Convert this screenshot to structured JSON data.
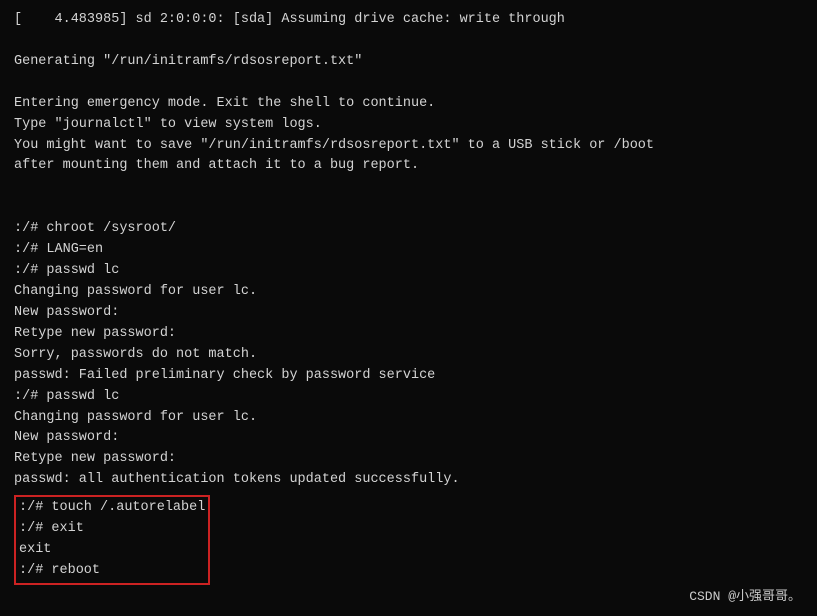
{
  "terminal": {
    "lines": [
      "[    4.483985] sd 2:0:0:0: [sda] Assuming drive cache: write through",
      "",
      "Generating \"/run/initramfs/rdsosreport.txt\"",
      "",
      "Entering emergency mode. Exit the shell to continue.",
      "Type \"journalctl\" to view system logs.",
      "You might want to save \"/run/initramfs/rdsosreport.txt\" to a USB stick or /boot",
      "after mounting them and attach it to a bug report.",
      "",
      "",
      ":/# chroot /sysroot/",
      ":/# LANG=en",
      ":/# passwd lc",
      "Changing password for user lc.",
      "New password:",
      "Retype new password:",
      "Sorry, passwords do not match.",
      "passwd: Failed preliminary check by password service",
      ":/# passwd lc",
      "Changing password for user lc.",
      "New password:",
      "Retype new password:",
      "passwd: all authentication tokens updated successfully."
    ],
    "highlighted_lines": [
      ":/# touch /.autorelabel",
      ":/# exit",
      "exit",
      ":/# reboot"
    ],
    "watermark": "CSDN @小强哥哥。"
  }
}
